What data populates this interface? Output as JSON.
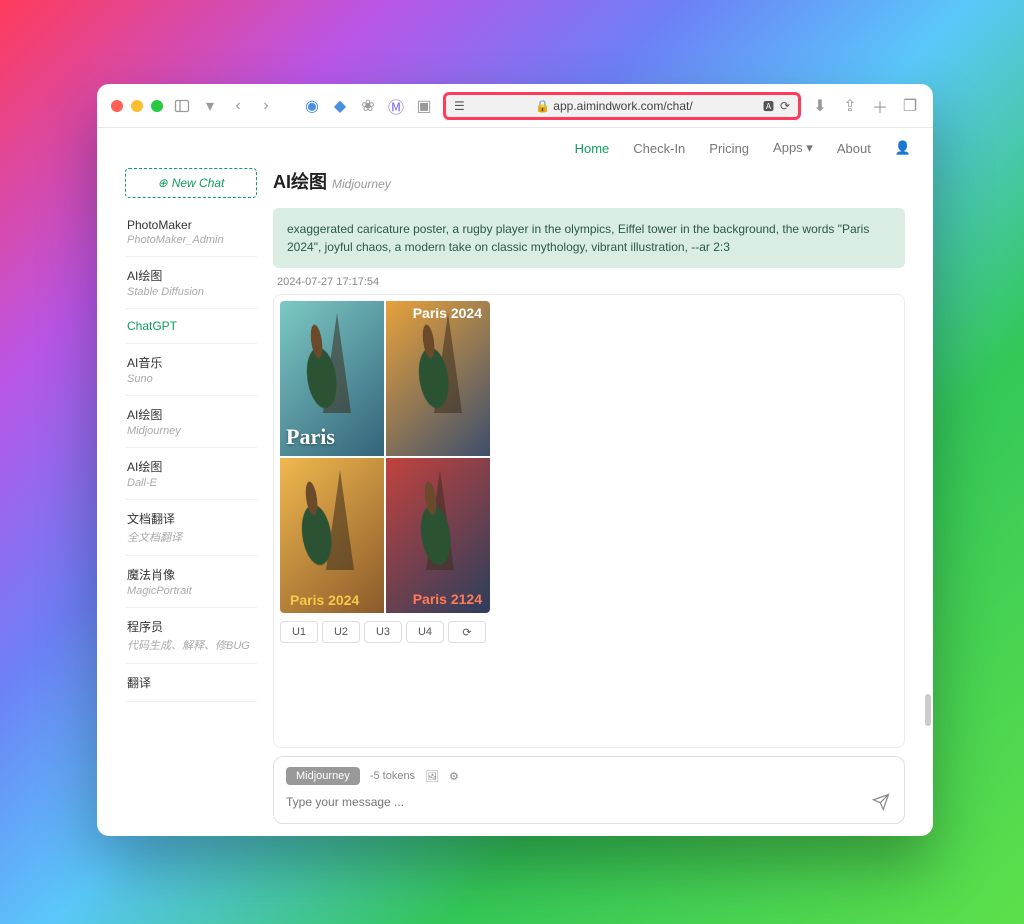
{
  "browser": {
    "url": "app.aimindwork.com/chat/"
  },
  "topnav": {
    "items": [
      "Home",
      "Check-In",
      "Pricing",
      "Apps ▾",
      "About"
    ],
    "activeIndex": 0
  },
  "sidebar": {
    "new_chat": "New Chat",
    "items": [
      {
        "title": "PhotoMaker",
        "sub": "PhotoMaker_Admin"
      },
      {
        "title": "AI绘图",
        "sub": "Stable Diffusion"
      },
      {
        "title": "ChatGPT",
        "sub": ""
      },
      {
        "title": "AI音乐",
        "sub": "Suno"
      },
      {
        "title": "AI绘图",
        "sub": "Midjourney"
      },
      {
        "title": "AI绘图",
        "sub": "Dall-E"
      },
      {
        "title": "文档翻译",
        "sub": "全文档翻译"
      },
      {
        "title": "魔法肖像",
        "sub": "MagicPortrait"
      },
      {
        "title": "程序员",
        "sub": "代码生成、解释、修BUG"
      },
      {
        "title": "翻译",
        "sub": ""
      }
    ],
    "selectedIndex": 2
  },
  "page": {
    "title": "AI绘图",
    "subtitle": "Midjourney"
  },
  "message": {
    "prompt": "exaggerated caricature poster, a rugby player in the olympics, Eiffel tower in the background, the words \"Paris 2024\", joyful chaos, a modern take on classic mythology, vibrant illustration, --ar 2:3",
    "timestamp": "2024-07-27 17:17:54",
    "buttons": [
      "U1",
      "U2",
      "U3",
      "U4",
      "⟳"
    ],
    "panel_labels": {
      "p1": "Paris",
      "p2_top": "Paris 2024",
      "p3": "Paris 2024",
      "p4": "Paris 2124"
    }
  },
  "input": {
    "model_badge": "Midjourney",
    "token_cost": "-5 tokens",
    "placeholder": "Type your message ..."
  }
}
